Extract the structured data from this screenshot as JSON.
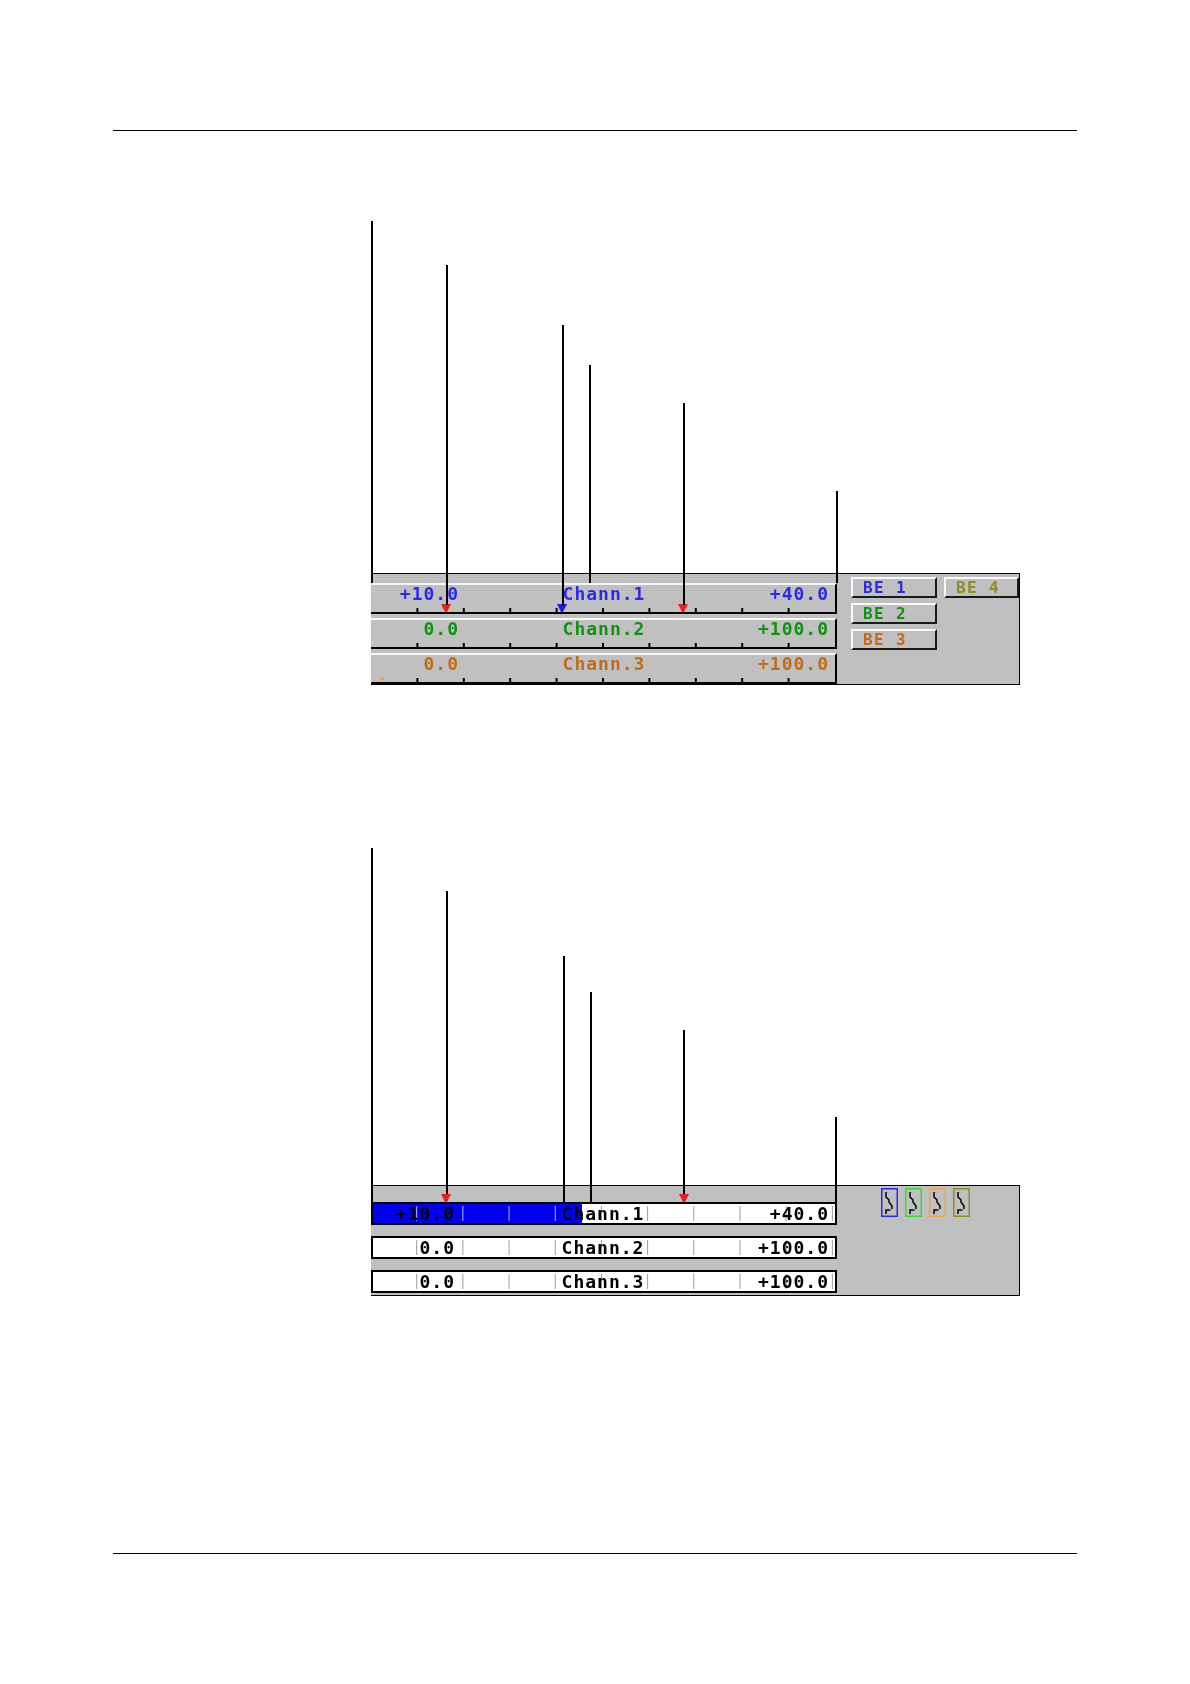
{
  "figures": [
    {
      "kind": "scale",
      "channels": [
        {
          "start": "+10.0",
          "name": "Chann.1",
          "end": "+40.0",
          "color": "#2a2aee",
          "markers": [
            {
              "kind": "pointer",
              "color": "#ee1c1c",
              "level": 0.161
            },
            {
              "kind": "pointer",
              "color": "#1c1cee",
              "level": 0.412
            },
            {
              "kind": "pointer",
              "color": "#ee1c1c",
              "level": 0.672
            }
          ]
        },
        {
          "start": "0.0",
          "name": "Chann.2",
          "end": "+100.0",
          "color": "#109410"
        },
        {
          "start": "0.0",
          "name": "Chann.3",
          "end": "+100.0",
          "color": "#c06c18",
          "markers": [
            {
              "kind": "dot",
              "color": "#f0a83a",
              "level": 0.024
            }
          ]
        }
      ],
      "buttons": [
        {
          "label": "BE 1",
          "color": "#2a2aee"
        },
        {
          "label": "BE 2",
          "color": "#109410"
        },
        {
          "label": "BE 3",
          "color": "#c06c18"
        },
        {
          "label": "BE 4",
          "color": "#8e8e1e"
        }
      ]
    },
    {
      "kind": "bar",
      "channels": [
        {
          "start": "+10.0",
          "name": "Chann.1",
          "end": "+40.0",
          "color": "#0000f0",
          "level": 0.453,
          "markers": [
            {
              "kind": "pointer",
              "color": "#ee1c1c",
              "level": 0.161
            },
            {
              "kind": "pointer",
              "color": "#ee1c1c",
              "level": 0.672
            }
          ]
        },
        {
          "start": "0.0",
          "name": "Chann.2",
          "end": "+100.0"
        },
        {
          "start": "0.0",
          "name": "Chann.3",
          "end": "+100.0"
        }
      ],
      "relays": [
        {
          "color": "#2a2aee"
        },
        {
          "color": "#2ee02e"
        },
        {
          "color": "#f0a83a"
        },
        {
          "color": "#8e8e1e"
        }
      ]
    }
  ]
}
